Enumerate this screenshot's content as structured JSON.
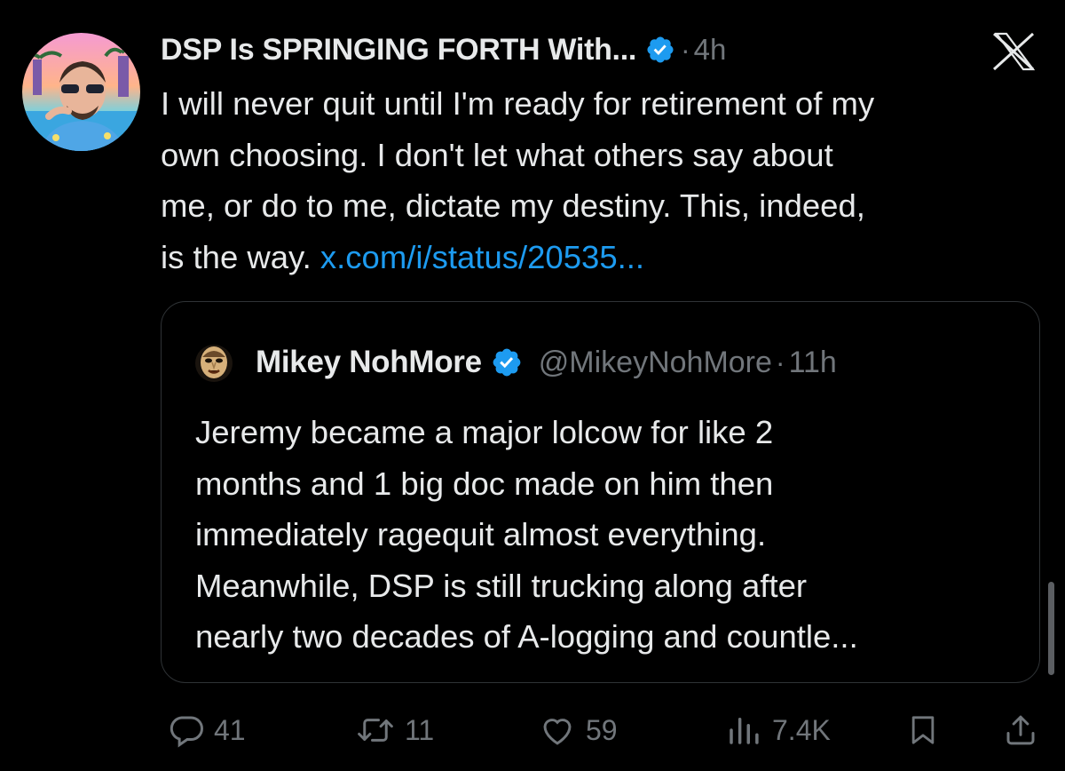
{
  "tweet": {
    "author_name": "DSP Is SPRINGING FORTH With...",
    "verified": true,
    "separator": "·",
    "time": "4h",
    "text_lines": [
      "I will never quit until I'm ready for retirement of my",
      "own choosing. I don't let what others say about",
      "me, or do to me, dictate my destiny. This, indeed,",
      "is the way. "
    ],
    "link": "x.com/i/status/20535..."
  },
  "quote": {
    "author_name": "Mikey NohMore",
    "verified": true,
    "handle": "@MikeyNohMore",
    "separator": "·",
    "time": "11h",
    "text_lines": [
      "Jeremy became a major lolcow for like 2",
      "months and 1 big doc made on him then",
      "immediately ragequit almost everything.",
      "Meanwhile, DSP is still trucking along after",
      "nearly two decades of A-logging and countle..."
    ]
  },
  "actions": {
    "replies": "41",
    "reposts": "11",
    "likes": "59",
    "views": "7.4K"
  },
  "colors": {
    "background": "#000000",
    "text": "#e7e9ea",
    "secondary": "#71767b",
    "link": "#1d9bf0",
    "verified": "#1d9bf0",
    "border": "#2f3336"
  },
  "icons": {
    "brand": "x-logo-icon",
    "verified": "verified-badge-icon",
    "reply": "reply-icon",
    "repost": "repost-icon",
    "like": "heart-icon",
    "views": "views-chart-icon",
    "bookmark": "bookmark-icon",
    "share": "share-icon"
  }
}
